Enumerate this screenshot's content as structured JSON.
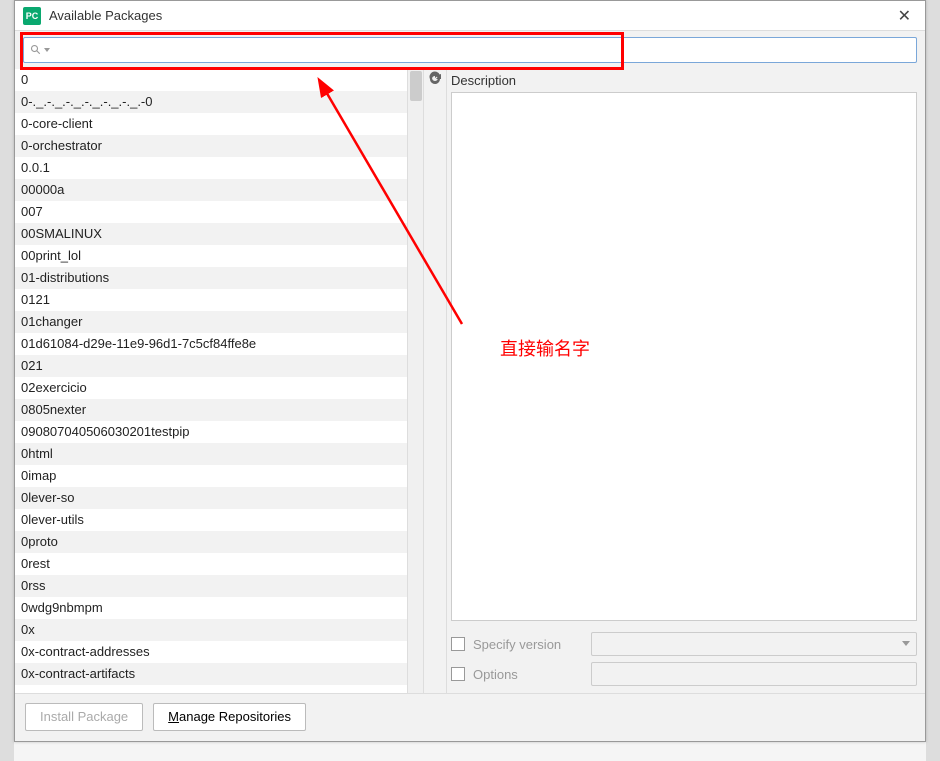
{
  "window": {
    "title": "Available Packages",
    "app_icon_text": "PC"
  },
  "search": {
    "value": "",
    "placeholder": ""
  },
  "packages": [
    "0",
    "0-._.-._.-._.-._.-._.-._.-0",
    "0-core-client",
    "0-orchestrator",
    "0.0.1",
    "00000a",
    "007",
    "00SMALINUX",
    "00print_lol",
    "01-distributions",
    "0121",
    "01changer",
    "01d61084-d29e-11e9-96d1-7c5cf84ffe8e",
    "021",
    "02exercicio",
    "0805nexter",
    "090807040506030201testpip",
    "0html",
    "0imap",
    "0lever-so",
    "0lever-utils",
    "0proto",
    "0rest",
    "0rss",
    "0wdg9nbmpm",
    "0x",
    "0x-contract-addresses",
    "0x-contract-artifacts"
  ],
  "right": {
    "description_label": "Description",
    "specify_version_label": "Specify version",
    "options_label": "Options"
  },
  "buttons": {
    "install": "Install Package",
    "manage_prefix": "M",
    "manage_rest": "anage Repositories"
  },
  "annotation": {
    "text": "直接输名字"
  }
}
